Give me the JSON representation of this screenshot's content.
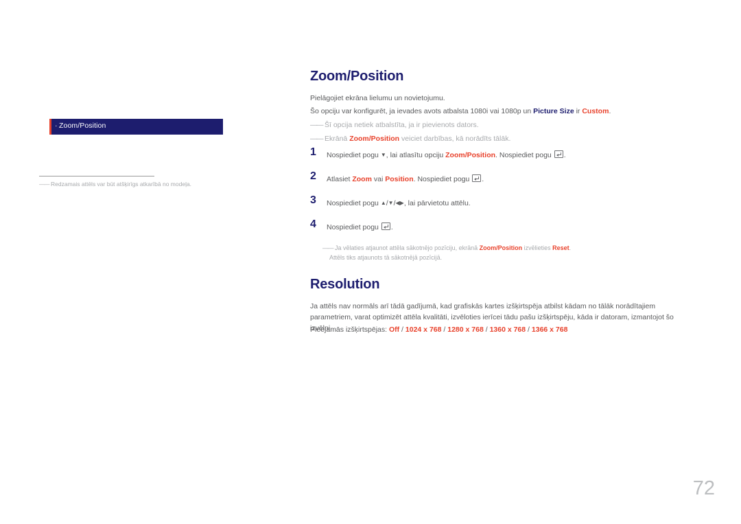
{
  "left": {
    "menu_item": {
      "bullet": "·",
      "label": "Zoom/Position"
    },
    "footnote": "Redzamais attēls var būt atšķirīgs atkarībā no modeļa."
  },
  "sections": {
    "zoom": {
      "title": "Zoom/Position",
      "intro": "Pielāgojiet ekrāna lielumu un novietojumu.",
      "line2_a": "Šo opciju var konfigurēt, ja ievades avots atbalsta 1080i vai 1080p un ",
      "line2_b": "Picture Size",
      "line2_c": " ir ",
      "line2_d": "Custom",
      "line2_e": ".",
      "note1": "Šī opcija netiek atbalstīta, ja ir pievienots dators.",
      "note2_a": "Ekrānā ",
      "note2_b": "Zoom/Position",
      "note2_c": " veiciet darbības, kā norādīts tālāk.",
      "steps": [
        {
          "num": "1",
          "a": "Nospiediet pogu ",
          "b": ", lai atlasītu opciju ",
          "c": "Zoom/Position",
          "d": ". Nospiediet pogu ",
          "e": "."
        },
        {
          "num": "2",
          "a": "Atlasiet ",
          "b": "Zoom",
          "c": " vai ",
          "d": "Position",
          "e": ". Nospiediet pogu ",
          "f": "."
        },
        {
          "num": "3",
          "a": "Nospiediet pogu ",
          "b": ", lai pārvietotu attēlu."
        },
        {
          "num": "4",
          "a": "Nospiediet pogu ",
          "b": "."
        }
      ],
      "result_note_a": "Ja vēlaties atjaunot attēla sākotnējo pozīciju, ekrānā ",
      "result_note_b": "Zoom/Position",
      "result_note_c": " izvēlieties ",
      "result_note_d": "Reset",
      "result_note_e": ".",
      "result_note_line2": "Attēls tiks atjaunots tā sākotnējā pozīcijā."
    },
    "resolution": {
      "title": "Resolution",
      "paragraph": "Ja attēls nav normāls arī tādā gadījumā, kad grafiskās kartes izšķirtspēja atbilst kādam no tālāk norādītajiem parametriem, varat optimizēt attēla kvalitāti, izvēloties ierīcei tādu pašu izšķirtspēju, kāda ir datoram, izmantojot šo izvēlni.",
      "list_label": "Pieejamās izšķirtspējas: ",
      "options": [
        "Off",
        "1024 x 768",
        "1280 x 768",
        "1360 x 768",
        "1366 x 768"
      ],
      "separator": " / "
    }
  },
  "page_number": "72",
  "colors": {
    "navy": "#1d1d6e",
    "red": "#e8412b",
    "gray_text": "#58595b",
    "light_gray": "#a7a9ac",
    "page_num": "#bcbec0"
  }
}
